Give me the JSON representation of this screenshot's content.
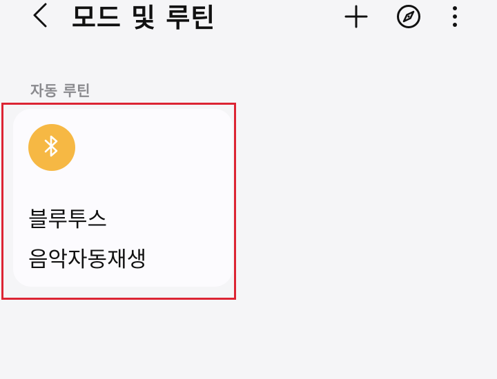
{
  "header": {
    "title": "모드 및 루틴",
    "back_icon": "chevron-left-icon",
    "add_icon": "plus-icon",
    "discover_icon": "compass-icon",
    "more_icon": "more-vertical-icon"
  },
  "section": {
    "title": "자동 루틴"
  },
  "routines": [
    {
      "icon": "bluetooth-icon",
      "icon_color": "#f6b844",
      "name": "블루투스\n음악자동재생"
    }
  ],
  "colors": {
    "background": "#f5f5f7",
    "card": "#fcfbfe",
    "highlight": "#dc2433",
    "section_text": "#8a8a8e"
  }
}
